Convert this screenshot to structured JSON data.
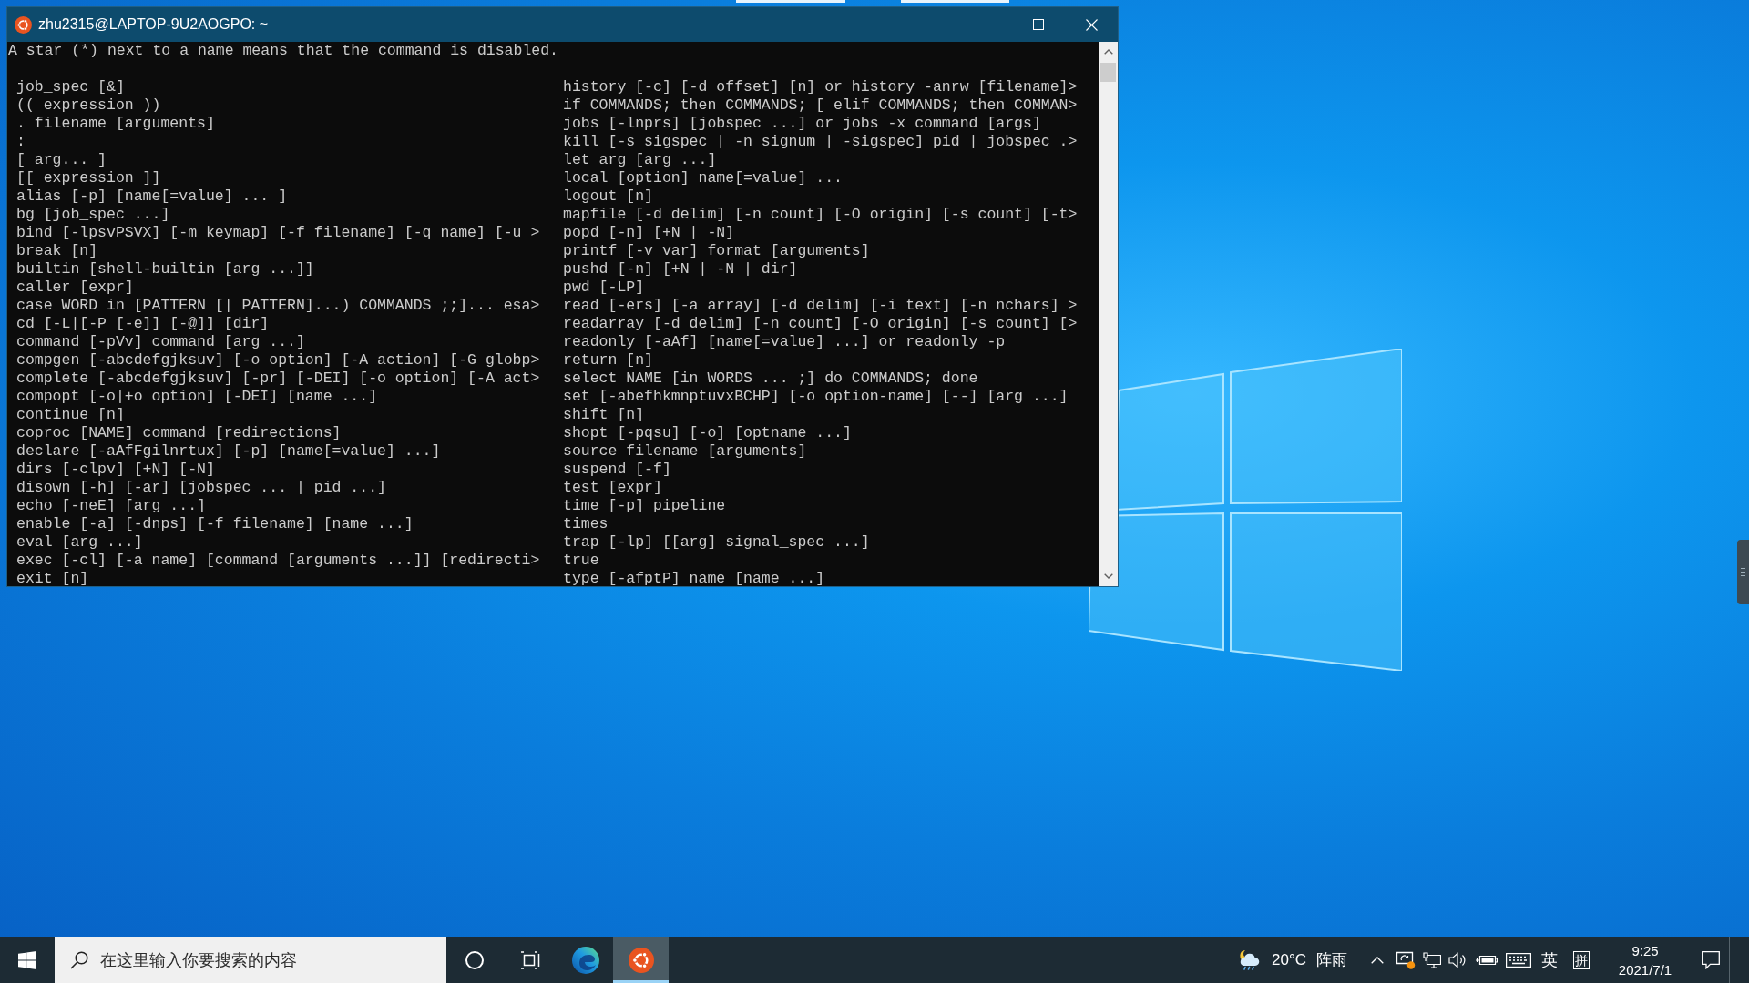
{
  "terminal": {
    "title": "zhu2315@LAPTOP-9U2AOGPO: ~",
    "intro": "A star (*) next to a name means that the command is disabled.",
    "left_column": [
      "job_spec [&]",
      "(( expression ))",
      ". filename [arguments]",
      ":",
      "[ arg... ]",
      "[[ expression ]]",
      "alias [-p] [name[=value] ... ]",
      "bg [job_spec ...]",
      "bind [-lpsvPSVX] [-m keymap] [-f filename] [-q name] [-u >",
      "break [n]",
      "builtin [shell-builtin [arg ...]]",
      "caller [expr]",
      "case WORD in [PATTERN [| PATTERN]...) COMMANDS ;;]... esa>",
      "cd [-L|[-P [-e]] [-@]] [dir]",
      "command [-pVv] command [arg ...]",
      "compgen [-abcdefgjksuv] [-o option] [-A action] [-G globp>",
      "complete [-abcdefgjksuv] [-pr] [-DEI] [-o option] [-A act>",
      "compopt [-o|+o option] [-DEI] [name ...]",
      "continue [n]",
      "coproc [NAME] command [redirections]",
      "declare [-aAfFgilnrtux] [-p] [name[=value] ...]",
      "dirs [-clpv] [+N] [-N]",
      "disown [-h] [-ar] [jobspec ... | pid ...]",
      "echo [-neE] [arg ...]",
      "enable [-a] [-dnps] [-f filename] [name ...]",
      "eval [arg ...]",
      "exec [-cl] [-a name] [command [arguments ...]] [redirecti>",
      "exit [n]"
    ],
    "right_column": [
      "history [-c] [-d offset] [n] or history -anrw [filename]>",
      "if COMMANDS; then COMMANDS; [ elif COMMANDS; then COMMAN>",
      "jobs [-lnprs] [jobspec ...] or jobs -x command [args]",
      "kill [-s sigspec | -n signum | -sigspec] pid | jobspec .>",
      "let arg [arg ...]",
      "local [option] name[=value] ...",
      "logout [n]",
      "mapfile [-d delim] [-n count] [-O origin] [-s count] [-t>",
      "popd [-n] [+N | -N]",
      "printf [-v var] format [arguments]",
      "pushd [-n] [+N | -N | dir]",
      "pwd [-LP]",
      "read [-ers] [-a array] [-d delim] [-i text] [-n nchars] >",
      "readarray [-d delim] [-n count] [-O origin] [-s count] [>",
      "readonly [-aAf] [name[=value] ...] or readonly -p",
      "return [n]",
      "select NAME [in WORDS ... ;] do COMMANDS; done",
      "set [-abefhkmnptuvxBCHP] [-o option-name] [--] [arg ...]",
      "shift [n]",
      "shopt [-pqsu] [-o] [optname ...]",
      "source filename [arguments]",
      "suspend [-f]",
      "test [expr]",
      "time [-p] pipeline",
      "times",
      "trap [-lp] [[arg] signal_spec ...]",
      "true",
      "type [-afptP] name [name ...]"
    ]
  },
  "taskbar": {
    "search": {
      "placeholder": "在这里输入你要搜索的内容"
    },
    "buttons": [
      {
        "kind": "search_circle",
        "selected": false
      },
      {
        "kind": "task_view",
        "selected": false
      },
      {
        "kind": "browser",
        "selected": false
      },
      {
        "kind": "terminal",
        "selected": true
      }
    ],
    "weather": {
      "temperature": "20°C",
      "condition": "阵雨"
    },
    "language": "英",
    "input_mode": "拼",
    "clock": {
      "time": "9:25",
      "date": "2021/7/1"
    }
  }
}
